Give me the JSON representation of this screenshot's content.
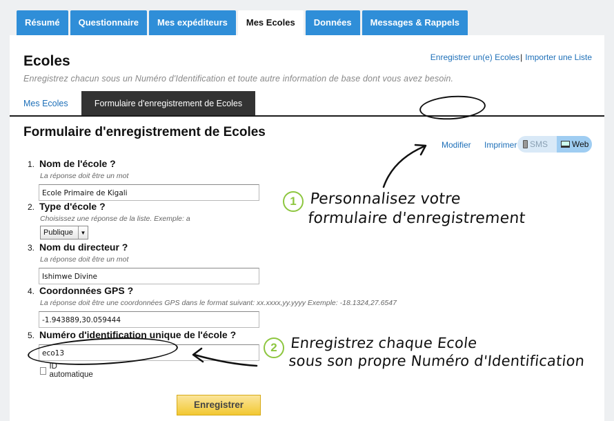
{
  "nav": {
    "tabs": [
      "Résumé",
      "Questionnaire",
      "Mes expéditeurs",
      "Mes Ecoles",
      "Données",
      "Messages & Rappels"
    ],
    "active_tab": "Mes Ecoles"
  },
  "page": {
    "title": "Ecoles",
    "subtitle": "Enregistrez chacun sous un Numéro d'Identification et toute autre information de base dont vous avez besoin.",
    "link_register": "Enregistrer un(e) Ecoles",
    "link_separator": "|",
    "link_import": "Importer une Liste"
  },
  "subtabs": {
    "list": "Mes Ecoles",
    "form": "Formulaire d'enregistrement de Ecoles"
  },
  "form": {
    "title": "Formulaire d'enregistrement de Ecoles",
    "modifier": "Modifier",
    "imprimer": "Imprimer",
    "sms": "SMS",
    "web": "Web",
    "questions": [
      {
        "num": "1.",
        "label": "Nom de l'école ?",
        "hint": "La réponse doit être un mot",
        "value": "Ecole Primaire de Kigali"
      },
      {
        "num": "2.",
        "label": "Type d'école ?",
        "hint": "Choisissez une réponse de la liste. Exemple: a",
        "value": "Publique"
      },
      {
        "num": "3.",
        "label": "Nom du directeur ?",
        "hint": "La réponse doit être un mot",
        "value": "Ishimwe Divine"
      },
      {
        "num": "4.",
        "label": "Coordonnées GPS ?",
        "hint": "La réponse doit être une coordonnées GPS dans le format suivant: xx.xxxx,yy.yyyy Exemple: -18.1324,27.6547",
        "value": "-1.943889,30.059444"
      },
      {
        "num": "5.",
        "label": "Numéro d'identification unique de l'école ?",
        "value": "eco13",
        "checkbox_label": "ID automatique"
      }
    ],
    "save_label": "Enregistrer"
  },
  "callouts": {
    "one": {
      "badge": "1",
      "line1": "Personnalisez votre",
      "line2": "formulaire d'enregistrement"
    },
    "two": {
      "badge": "2",
      "line1": "Enregistrez chaque Ecole",
      "line2": "sous son propre Numéro d'Identification"
    }
  },
  "colors": {
    "nav_blue": "#2f8ed8",
    "link_blue": "#1d6fb8",
    "callout_green": "#8dc63f",
    "save_yellow": "#f2c832"
  }
}
